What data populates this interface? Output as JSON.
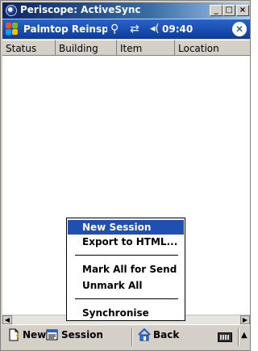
{
  "window": {
    "title": "Periscope: ActiveSync",
    "minimize_glyph": "_",
    "maximize_glyph": "□",
    "close_glyph": "×"
  },
  "navbar": {
    "title": "Palmtop Reinspection",
    "time": "09:40",
    "ok_glyph": "✕"
  },
  "list": {
    "columns": [
      "Status",
      "Building",
      "Item",
      "Location"
    ]
  },
  "context_menu": {
    "items": [
      {
        "label": "New Session",
        "selected": true
      },
      {
        "label": "Export to HTML...",
        "selected": false
      },
      {
        "label": "Mark All for Send",
        "selected": false
      },
      {
        "label": "Unmark All",
        "selected": false
      },
      {
        "label": "Synchronise",
        "selected": false
      }
    ]
  },
  "command_bar": {
    "new_label": "New",
    "session_label": "Session",
    "back_label": "Back"
  },
  "colors": {
    "titlebar": "#0a246a",
    "navbar": "#0b3c9c",
    "menu_highlight": "#1f4fb0",
    "chrome": "#d4d0c8"
  },
  "icons": [
    "app-icon",
    "windows-start-icon",
    "connectivity-icon",
    "sync-icon",
    "volume-icon",
    "ok-close-icon",
    "new-document-icon",
    "session-icon",
    "home-icon",
    "keyboard-icon",
    "sip-arrow-icon"
  ]
}
